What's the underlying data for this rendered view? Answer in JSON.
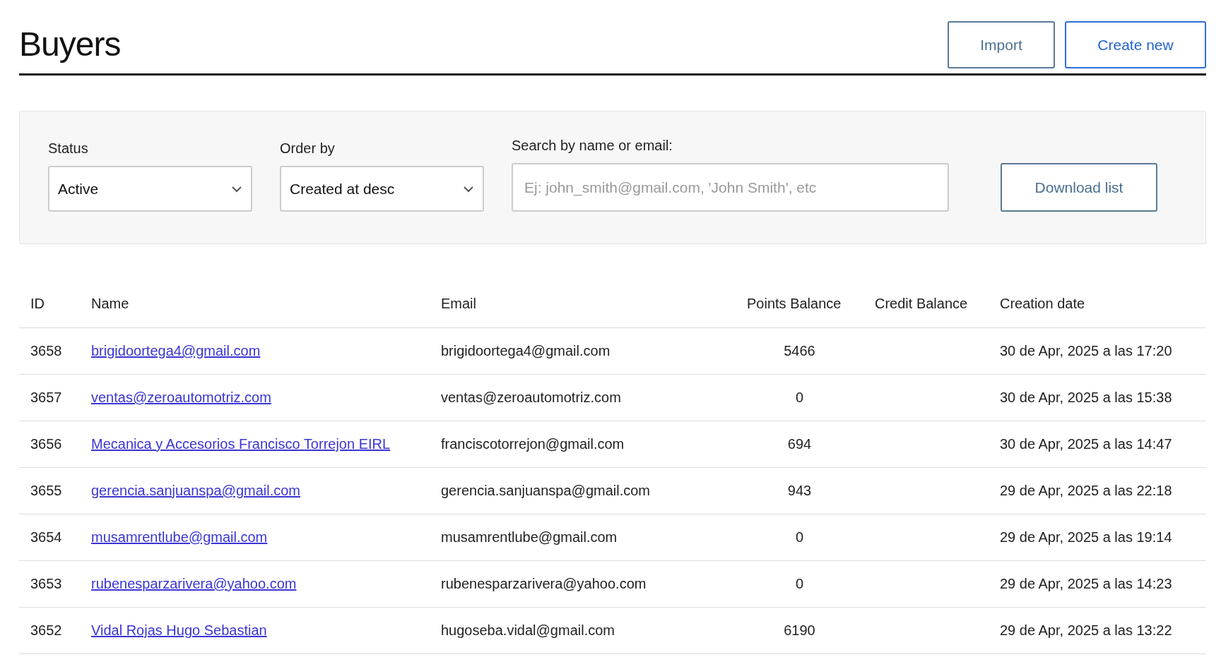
{
  "header": {
    "title": "Buyers",
    "buttons": [
      {
        "label": "Import",
        "kind": "secondary"
      },
      {
        "label": "Create new",
        "kind": "primary"
      }
    ]
  },
  "filters": {
    "status": {
      "label": "Status",
      "value": "Active"
    },
    "order_by": {
      "label": "Order by",
      "value": "Created at desc"
    },
    "search": {
      "label": "Search by name or email:",
      "placeholder": "Ej: john_smith@gmail.com, 'John Smith', etc"
    },
    "download_button": "Download list"
  },
  "table": {
    "columns": [
      "ID",
      "Name",
      "Email",
      "Points Balance",
      "Credit Balance",
      "Creation date"
    ],
    "rows": [
      {
        "id": "3658",
        "name": "brigidoortega4@gmail.com",
        "email": "brigidoortega4@gmail.com",
        "points": "5466",
        "credit": "",
        "date": "30 de Apr, 2025 a las 17:20"
      },
      {
        "id": "3657",
        "name": "ventas@zeroautomotriz.com",
        "email": "ventas@zeroautomotriz.com",
        "points": "0",
        "credit": "",
        "date": "30 de Apr, 2025 a las 15:38"
      },
      {
        "id": "3656",
        "name": "Mecanica y Accesorios Francisco Torrejon EIRL",
        "email": "franciscotorrejon@gmail.com",
        "points": "694",
        "credit": "",
        "date": "30 de Apr, 2025 a las 14:47"
      },
      {
        "id": "3655",
        "name": "gerencia.sanjuanspa@gmail.com",
        "email": "gerencia.sanjuanspa@gmail.com",
        "points": "943",
        "credit": "",
        "date": "29 de Apr, 2025 a las 22:18"
      },
      {
        "id": "3654",
        "name": "musamrentlube@gmail.com",
        "email": "musamrentlube@gmail.com",
        "points": "0",
        "credit": "",
        "date": "29 de Apr, 2025 a las 19:14"
      },
      {
        "id": "3653",
        "name": "rubenesparzarivera@yahoo.com",
        "email": "rubenesparzarivera@yahoo.com",
        "points": "0",
        "credit": "",
        "date": "29 de Apr, 2025 a las 14:23"
      },
      {
        "id": "3652",
        "name": "Vidal Rojas Hugo Sebastian",
        "email": "hugoseba.vidal@gmail.com",
        "points": "6190",
        "credit": "",
        "date": "29 de Apr, 2025 a las 13:22"
      }
    ]
  }
}
